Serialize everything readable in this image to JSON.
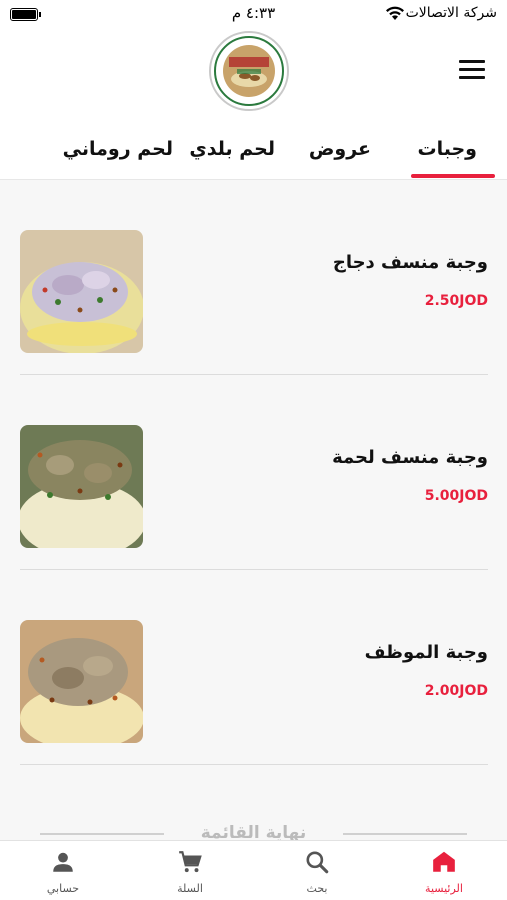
{
  "status_bar": {
    "time": "٤:٣٣ م",
    "carrier": "شركة الاتصالات"
  },
  "header": {
    "menu_icon": "hamburger-menu-icon",
    "logo": "restaurant-logo"
  },
  "tabs": [
    {
      "label": "وجبات",
      "active": true
    },
    {
      "label": "عروض",
      "active": false
    },
    {
      "label": "لحم بلدي",
      "active": false
    },
    {
      "label": "لحم روماني",
      "active": false
    }
  ],
  "items": [
    {
      "name": "وجبة منسف دجاج",
      "price": "2.50JOD"
    },
    {
      "name": "وجبة منسف لحمة",
      "price": "5.00JOD"
    },
    {
      "name": "وجبة الموظف",
      "price": "2.00JOD"
    }
  ],
  "list_end": {
    "label": "نهاية القائمة"
  },
  "bottom_nav": [
    {
      "label": "الرئيسية",
      "icon": "home-icon",
      "active": true
    },
    {
      "label": "بحث",
      "icon": "search-icon",
      "active": false
    },
    {
      "label": "السلة",
      "icon": "cart-icon",
      "active": false
    },
    {
      "label": "حسابي",
      "icon": "user-icon",
      "active": false
    }
  ],
  "colors": {
    "accent": "#e8203d",
    "background": "#f7f7f7"
  }
}
